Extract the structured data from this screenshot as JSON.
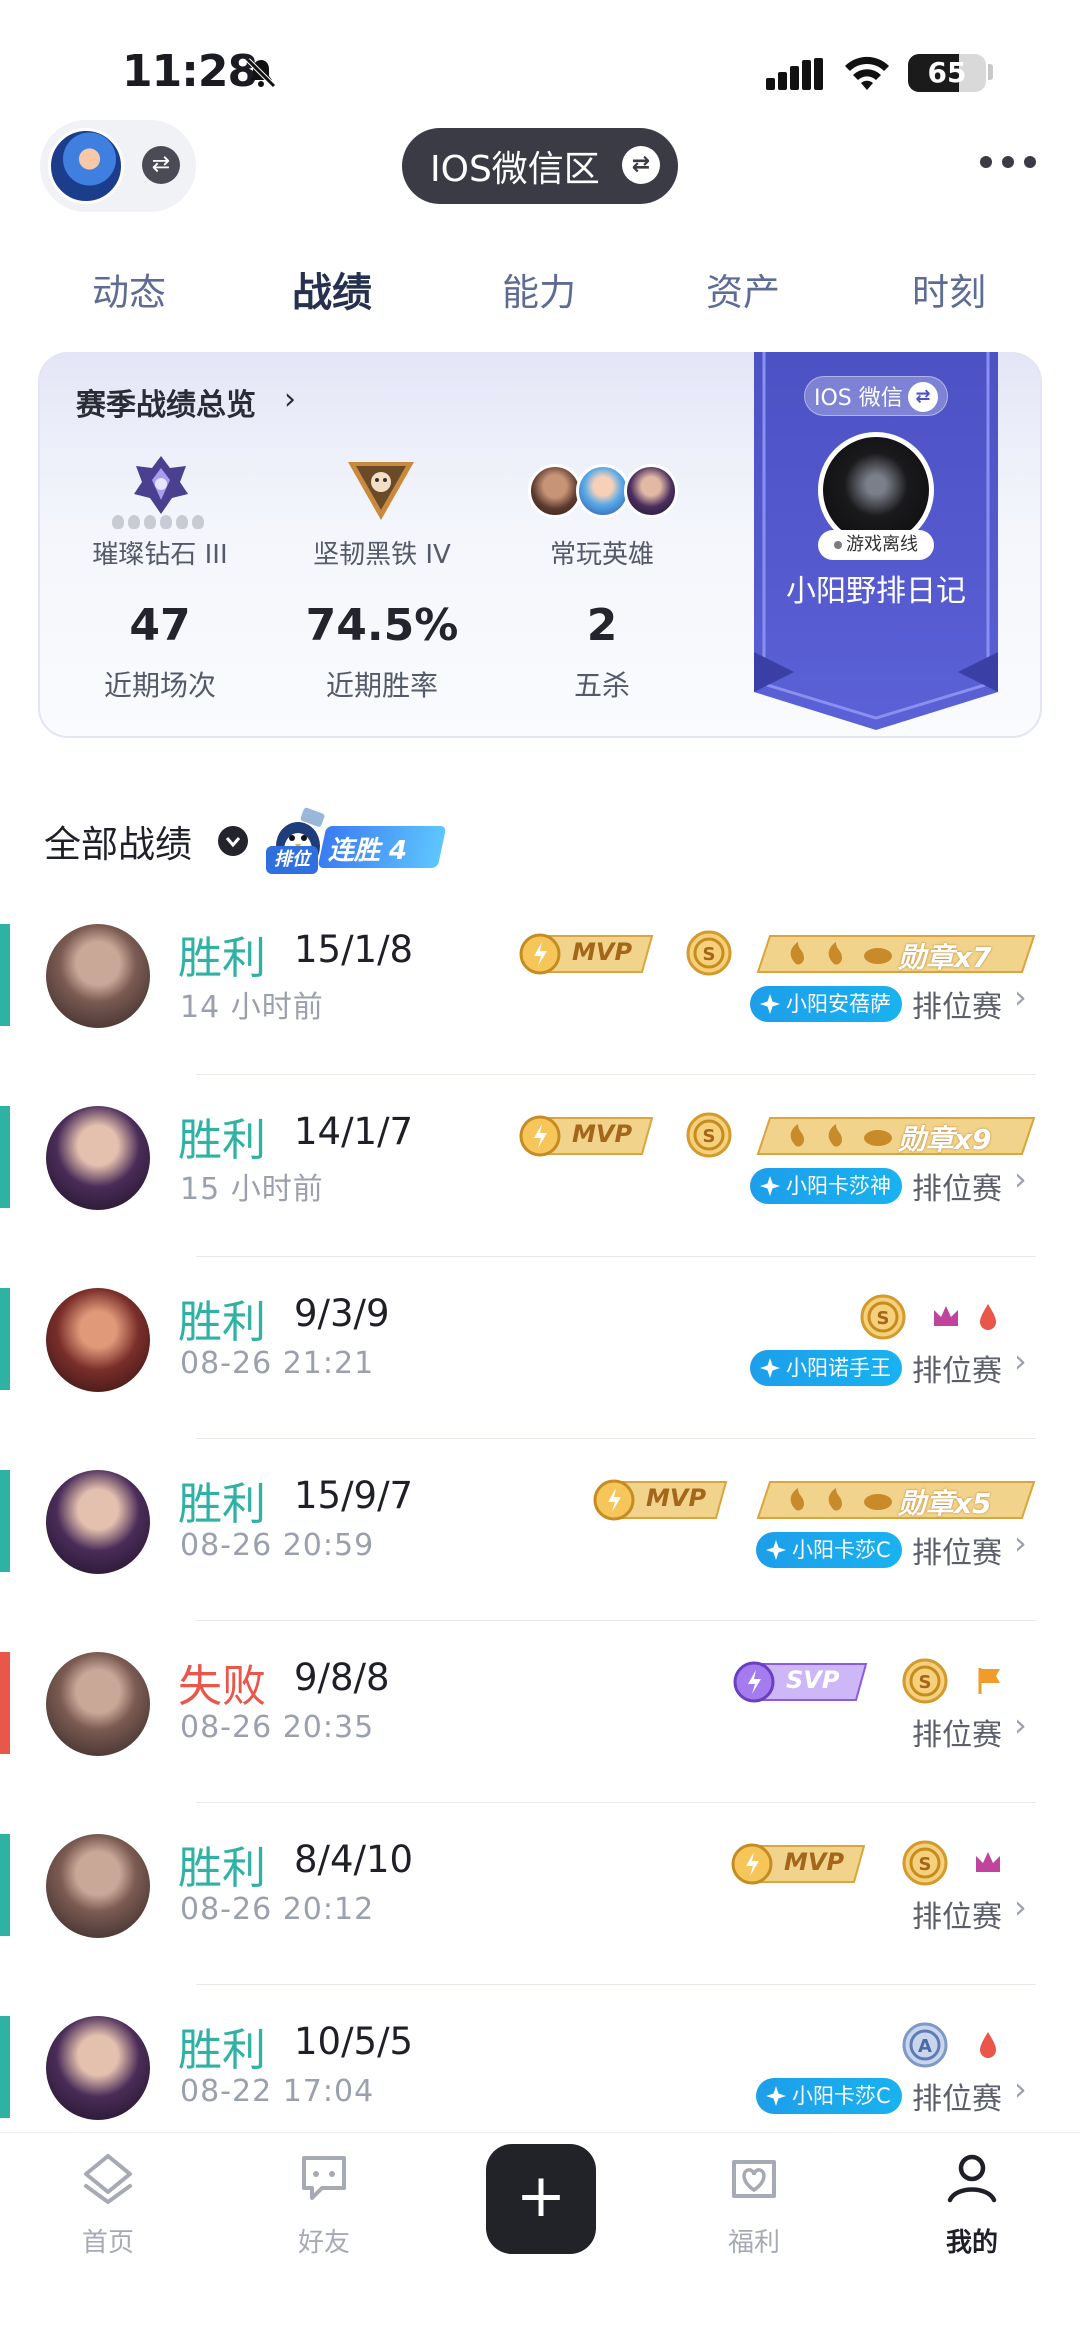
{
  "status_bar": {
    "time": "11:28",
    "battery": "65",
    "battery_level": 0.65
  },
  "header": {
    "region_label": "IOS微信区",
    "more_icon": "more-icon",
    "swap_icon": "swap-icon"
  },
  "tabs": [
    {
      "label": "动态",
      "active": false
    },
    {
      "label": "战绩",
      "active": true
    },
    {
      "label": "能力",
      "active": false
    },
    {
      "label": "资产",
      "active": false
    },
    {
      "label": "时刻",
      "active": false
    }
  ],
  "season": {
    "title": "赛季战绩总览",
    "rank_1": "璀璨钻石 III",
    "rank_2": "坚韧黑铁 IV",
    "heroes_label": "常玩英雄",
    "recent_games": "47",
    "recent_games_label": "近期场次",
    "win_rate": "74.5%",
    "win_rate_label": "近期胜率",
    "penta": "2",
    "penta_label": "五杀"
  },
  "banner": {
    "region": "IOS 微信",
    "status": "游戏离线",
    "name": "小阳野排日记"
  },
  "filter": {
    "label": "全部战绩",
    "streak_rank": "排位",
    "streak_text": "连胜 4"
  },
  "matches": [
    {
      "result": "胜利",
      "kda": "15/1/8",
      "time": "14 小时前",
      "mode": "排位赛",
      "hero_tag": "小阳安蓓萨",
      "mvp": "MVP",
      "medal": "勋章x7"
    },
    {
      "result": "胜利",
      "kda": "14/1/7",
      "time": "15 小时前",
      "mode": "排位赛",
      "hero_tag": "小阳卡莎神",
      "mvp": "MVP",
      "medal": "勋章x9"
    },
    {
      "result": "胜利",
      "kda": "9/3/9",
      "time": "08-26 21:21",
      "mode": "排位赛",
      "hero_tag": "小阳诺手王"
    },
    {
      "result": "胜利",
      "kda": "15/9/7",
      "time": "08-26 20:59",
      "mode": "排位赛",
      "hero_tag": "小阳卡莎C",
      "mvp": "MVP",
      "medal": "勋章x5"
    },
    {
      "result": "失败",
      "kda": "9/8/8",
      "time": "08-26 20:35",
      "mode": "排位赛",
      "svp": "SVP"
    },
    {
      "result": "胜利",
      "kda": "8/4/10",
      "time": "08-26 20:12",
      "mode": "排位赛",
      "mvp": "MVP"
    },
    {
      "result": "胜利",
      "kda": "10/5/5",
      "time": "08-22 17:04",
      "mode": "排位赛",
      "hero_tag": "小阳卡莎C"
    }
  ],
  "bottom_nav": [
    {
      "label": "首页",
      "icon": "home-icon"
    },
    {
      "label": "好友",
      "icon": "chat-icon"
    },
    {
      "label": "",
      "icon": "plus-icon"
    },
    {
      "label": "福利",
      "icon": "gift-icon"
    },
    {
      "label": "我的",
      "icon": "profile-icon",
      "active": true
    }
  ],
  "colors": {
    "win": "#2fb1a3",
    "lose": "#e9574a",
    "banner": "#4c52c4",
    "hero_tag": "#1d9eea",
    "mvp_gold": "#d9a53c",
    "svp_purple": "#8a5be0"
  }
}
